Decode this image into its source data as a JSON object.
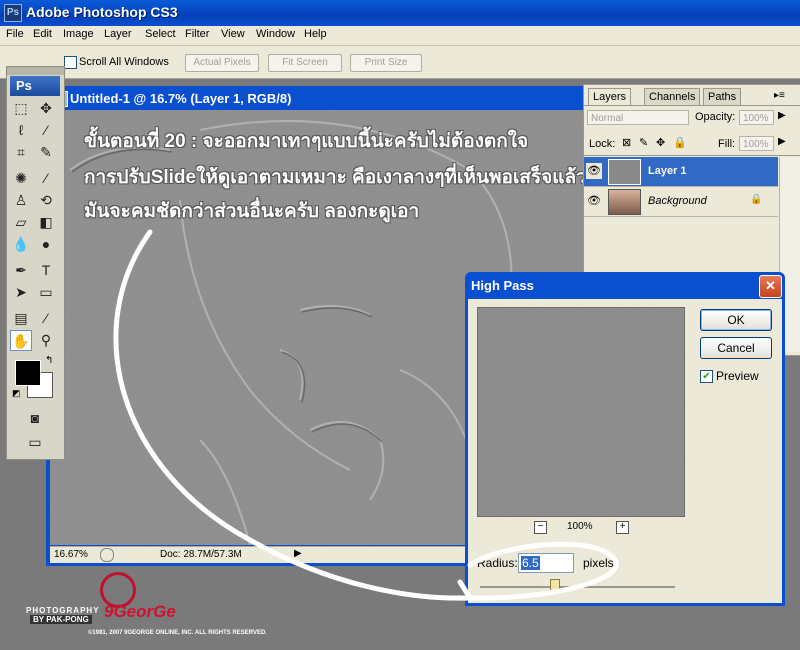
{
  "app": {
    "title": "Adobe Photoshop CS3",
    "logo": "Ps"
  },
  "menu": [
    "File",
    "Edit",
    "Image",
    "Layer",
    "Select",
    "Filter",
    "View",
    "Window",
    "Help"
  ],
  "options": {
    "scroll_all_windows": "Scroll All Windows",
    "actual_pixels": "Actual Pixels",
    "fit_screen": "Fit Screen",
    "print_size": "Print Size"
  },
  "toolbox": {
    "logo": "Ps"
  },
  "document": {
    "title": "Untitled-1 @ 16.7% (Layer 1, RGB/8)",
    "zoom": "16.67%",
    "doc_size": "Doc: 28.7M/57.3M"
  },
  "overlay": {
    "line1": "ขั้นตอนที่ 20 : จะออกมาเทาๆแบบนี้น่ะครับไม่ต้องตกใจ",
    "line2": "การปรับSlideให้ดูเอาตามเหมาะ คือเงาลางๆที่เห็นพอเสร็จแล้ว",
    "line3": "มันจะคมชัดกว่าส่วนอื่นะครับ ลองกะดูเอา"
  },
  "layers_panel": {
    "tabs": [
      "Layers",
      "Channels",
      "Paths"
    ],
    "blend_mode": "Normal",
    "opacity_label": "Opacity:",
    "opacity_value": "100%",
    "lock_label": "Lock:",
    "fill_label": "Fill:",
    "fill_value": "100%",
    "layers": [
      {
        "name": "Layer 1",
        "selected": true
      },
      {
        "name": "Background",
        "selected": false,
        "locked": true
      }
    ]
  },
  "high_pass": {
    "title": "High Pass",
    "ok": "OK",
    "cancel": "Cancel",
    "preview_label": "Preview",
    "preview_checked": true,
    "zoom": "100%",
    "zoom_out": "−",
    "zoom_in": "+",
    "radius_label": "Radius:",
    "radius_value": "6.5",
    "unit": "pixels",
    "slider_level": 0.38
  },
  "watermark": {
    "photography": "PHOTOGRAPHY",
    "by": "BY PAK-PONG",
    "brand": "9GeorGe",
    "copyright": "©1981, 2007 9GEORGE ONLINE, INC. ALL RIGHTS RESERVED."
  },
  "colors": {
    "xp_blue": "#0a4fd0",
    "selected_layer": "#316ac5",
    "panel": "#ece9d8"
  }
}
